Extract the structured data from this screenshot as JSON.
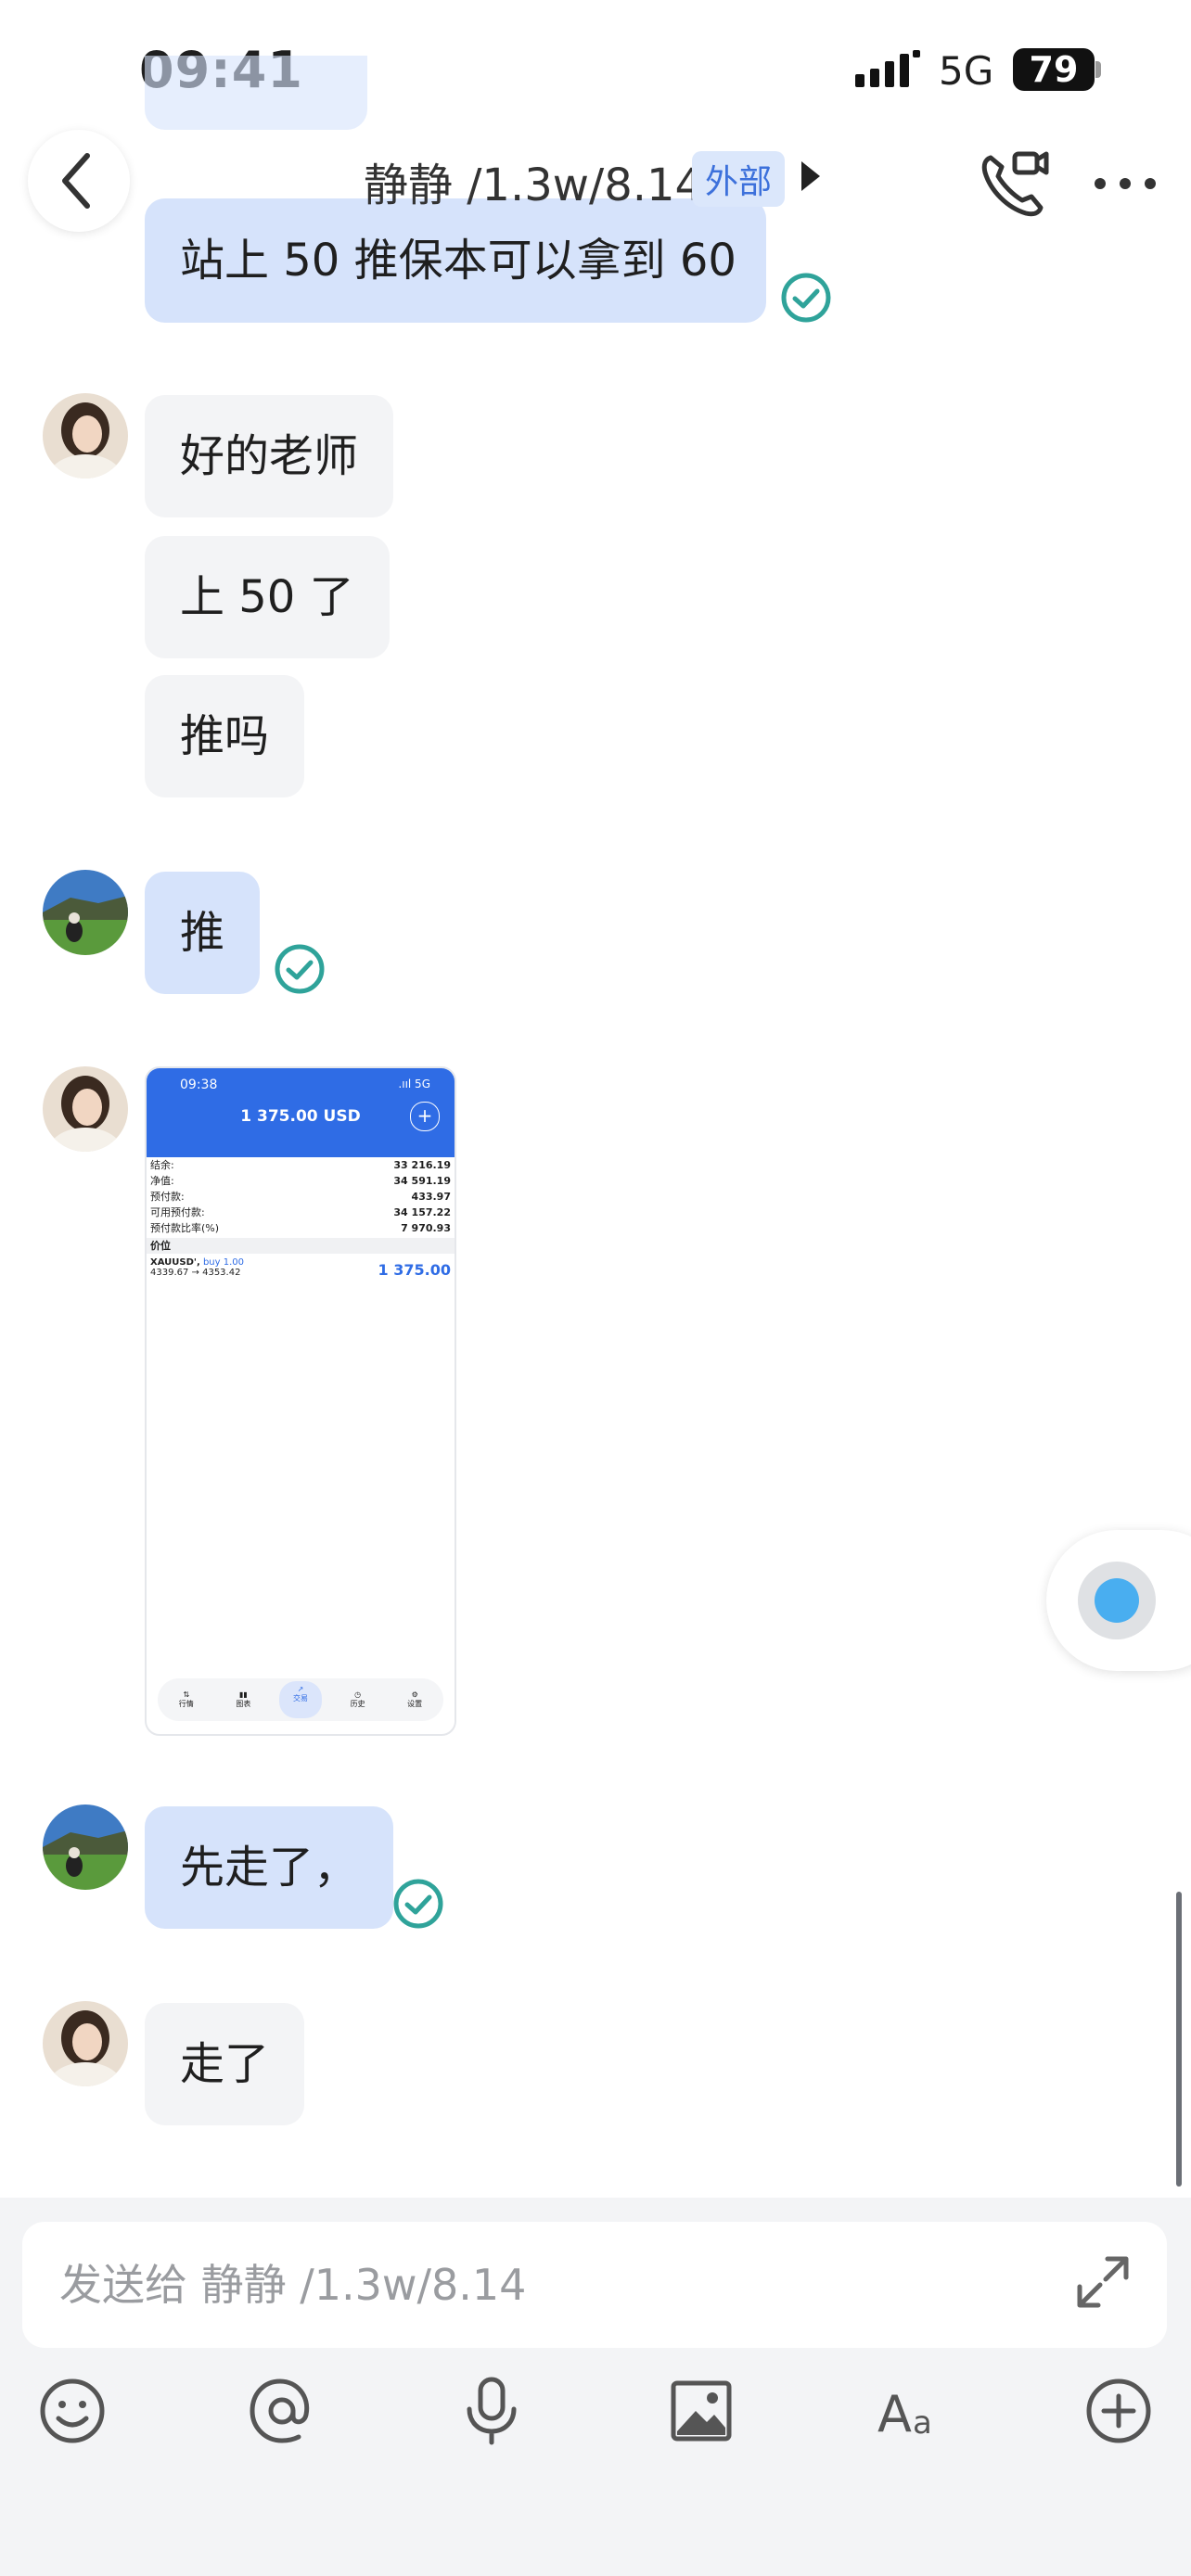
{
  "status": {
    "time": "09:41",
    "network": "5G",
    "battery": "79"
  },
  "header": {
    "title": "静静 /1.3w/8.14",
    "tag": "外部"
  },
  "messages": {
    "top_partial": "站上 50 推保本可以拿到 60",
    "m1": "好的老师",
    "m2": "上 50 了",
    "m3": "推吗",
    "m4": "推",
    "m5": "先走了，",
    "m6": "走了"
  },
  "screenshot": {
    "time": "09:38",
    "signal": ".ııl 5G",
    "amount": "1 375.00 USD",
    "rows": [
      {
        "label": "结余:",
        "value": "33 216.19"
      },
      {
        "label": "净值:",
        "value": "34 591.19"
      },
      {
        "label": "预付款:",
        "value": "433.97"
      },
      {
        "label": "可用预付款:",
        "value": "34 157.22"
      },
      {
        "label": "预付款比率(%)",
        "value": "7 970.93"
      }
    ],
    "section": "价位",
    "position": {
      "symbol": "XAUUSD',",
      "side": "buy 1.00",
      "prices": "4339.67 → 4353.42",
      "profit": "1 375.00"
    },
    "tabs": [
      "行情",
      "图表",
      "交易",
      "历史",
      "设置"
    ]
  },
  "composer": {
    "placeholder": "发送给 静静 /1.3w/8.14"
  },
  "colors": {
    "accent": "#3d71db",
    "outgoing_bubble": "#d6e3fb",
    "incoming_bubble": "#f3f4f6",
    "read_check": "#2fa39a"
  }
}
